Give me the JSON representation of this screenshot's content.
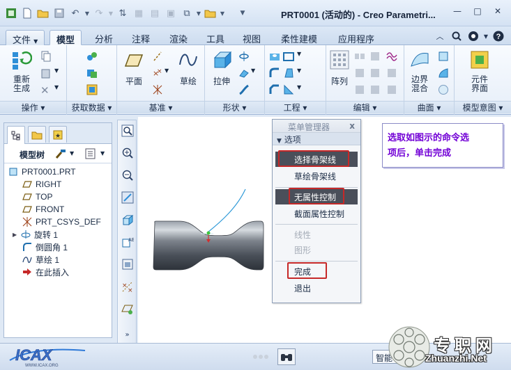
{
  "window": {
    "title": "PRT0001 (活动的) - Creo Parametri..."
  },
  "tabs": [
    "文件",
    "模型",
    "分析",
    "注释",
    "渲染",
    "工具",
    "视图",
    "柔性建模",
    "应用程序"
  ],
  "ribbon": {
    "groups": [
      {
        "label": "操作",
        "big": [
          "重新生成"
        ]
      },
      {
        "label": "获取数据"
      },
      {
        "label": "基准",
        "big": [
          "平面",
          "草绘"
        ]
      },
      {
        "label": "形状",
        "big": [
          "拉伸"
        ]
      },
      {
        "label": "工程"
      },
      {
        "label": "编辑",
        "big": [
          "阵列"
        ]
      },
      {
        "label": "曲面",
        "big": [
          "边界混合"
        ]
      },
      {
        "label": "模型意图",
        "big": [
          "元件界面"
        ]
      }
    ]
  },
  "model_tree": {
    "header": "模型树",
    "items": [
      "PRT0001.PRT",
      "RIGHT",
      "TOP",
      "FRONT",
      "PRT_CSYS_DEF",
      "旋转 1",
      "倒圆角 1",
      "草绘 1",
      "在此插入"
    ]
  },
  "menu_manager": {
    "title": "菜单管理器",
    "close": "x",
    "section": "选项",
    "items": [
      {
        "label": "选择骨架线",
        "state": "selected"
      },
      {
        "label": "草绘骨架线",
        "state": "normal"
      },
      {
        "label": "无属性控制",
        "state": "selected"
      },
      {
        "label": "截面属性控制",
        "state": "normal"
      },
      {
        "label": "线性",
        "state": "disabled"
      },
      {
        "label": "图形",
        "state": "disabled"
      },
      {
        "label": "完成",
        "state": "normal"
      },
      {
        "label": "退出",
        "state": "normal"
      }
    ]
  },
  "callout": {
    "line1": "选取如图示的命令选",
    "line2": "项后，单击完成"
  },
  "status": {
    "smart": "智能"
  },
  "watermark": {
    "left": "ICAX",
    "left_url": "WWW.ICAX.ORG",
    "cn": "专职网",
    "url": "Zhuanzhi.Net"
  },
  "colors": {
    "accent_red": "#c62828",
    "callout_text": "#7200d6",
    "selected_bg": "#4a4f5a"
  }
}
